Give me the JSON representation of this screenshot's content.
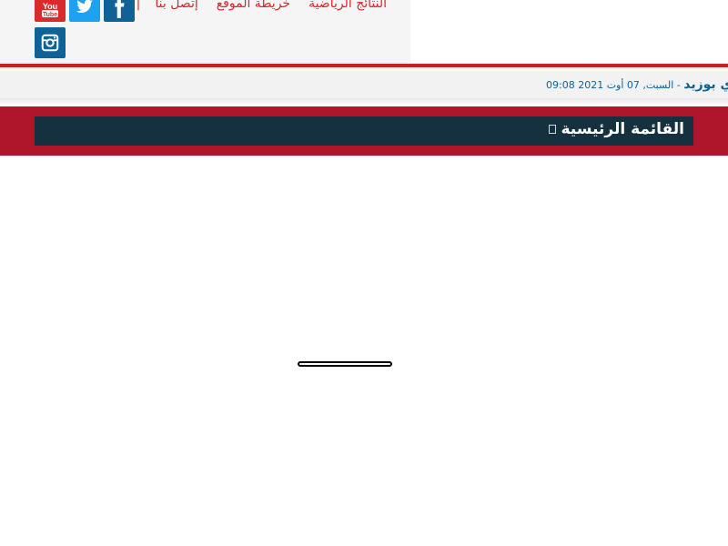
{
  "header": {
    "links": [
      {
        "label": "النتائج الرياضية"
      },
      {
        "label": "خريطة الموقع"
      },
      {
        "label": "إتصل بنا"
      }
    ],
    "separator": "|",
    "social": [
      {
        "name": "youtube",
        "icon": "youtube-icon",
        "color": "#d92b2b"
      },
      {
        "name": "twitter",
        "icon": "twitter-icon",
        "color": "#1da1f2"
      },
      {
        "name": "facebook",
        "icon": "facebook-icon",
        "color": "#0f6196"
      },
      {
        "name": "instagram",
        "icon": "instagram-icon",
        "color": "#0f6196"
      }
    ]
  },
  "ticker": {
    "city": "دي بوزيد",
    "dash": " - ",
    "date": "السبت, 07 أوت 2021 09:08"
  },
  "nav": {
    "title": "القائمة الرئيسية",
    "menu_icon": "menu-icon"
  },
  "colors": {
    "brand_red": "#c8201e",
    "nav_band": "#b0162b",
    "nav_bar": "#15303f",
    "link_blue": "#0f6196"
  }
}
